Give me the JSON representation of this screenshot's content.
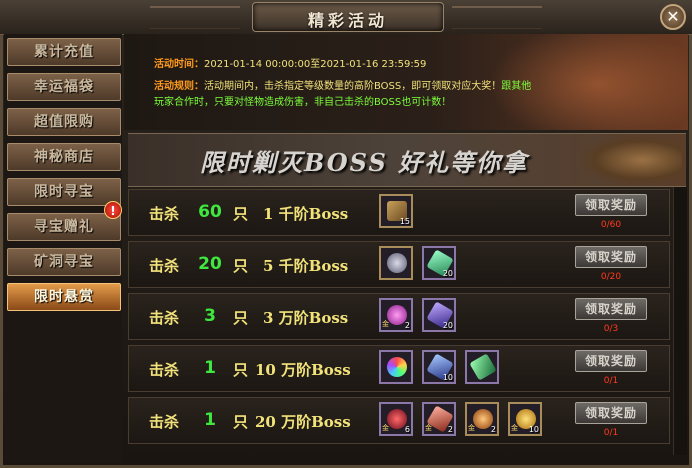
{
  "window": {
    "title": "精彩活动",
    "close_icon": "close-icon"
  },
  "sidebar": {
    "items": [
      {
        "label": "累计充值"
      },
      {
        "label": "幸运福袋"
      },
      {
        "label": "超值限购"
      },
      {
        "label": "神秘商店"
      },
      {
        "label": "限时寻宝"
      },
      {
        "label": "寻宝赠礼"
      },
      {
        "label": "矿洞寻宝",
        "badge": "!"
      },
      {
        "label": "限时悬赏",
        "active": true
      }
    ]
  },
  "info": {
    "time_label": "活动时间：",
    "time_value": "2021-01-14 00:00:00至2021-01-16 23:59:59",
    "rule_label": "活动规则：",
    "rule_text_1": "活动期间内，击杀指定等级数量的高阶BOSS，即可领取对应大奖！",
    "rule_text_green_1": "跟其他",
    "rule_text_green_2": "玩家合作时，只要对怪物造成伤害，非自己击杀的BOSS也可计数！"
  },
  "banner": {
    "text": "限时剿灭BOSS  好礼等你拿"
  },
  "rows": [
    {
      "kill": "击杀",
      "count": "60",
      "unit": "只",
      "boss": "1  千阶Boss",
      "claim": "领取奖励",
      "progress": "0/60",
      "items": [
        {
          "icon": "treasure-chest-icon",
          "qty": "15"
        }
      ]
    },
    {
      "kill": "击杀",
      "count": "20",
      "unit": "只",
      "boss": "5  千阶Boss",
      "claim": "领取奖励",
      "progress": "0/20",
      "items": [
        {
          "icon": "coin-icon",
          "qty": ""
        },
        {
          "icon": "green-crystal-icon",
          "qty": "20"
        }
      ]
    },
    {
      "kill": "击杀",
      "count": "3",
      "unit": "只",
      "boss": "3  万阶Boss",
      "claim": "领取奖励",
      "progress": "0/3",
      "items": [
        {
          "icon": "purple-gem-icon",
          "qty": "2"
        },
        {
          "icon": "purple-crystal-icon",
          "qty": "20"
        }
      ]
    },
    {
      "kill": "击杀",
      "count": "1",
      "unit": "只",
      "boss": "10 万阶Boss",
      "claim": "领取奖励",
      "progress": "0/1",
      "items": [
        {
          "icon": "rainbow-orb-icon",
          "qty": ""
        },
        {
          "icon": "blue-crystal-icon",
          "qty": "10"
        },
        {
          "icon": "green-shard-icon",
          "qty": ""
        }
      ]
    },
    {
      "kill": "击杀",
      "count": "1",
      "unit": "只",
      "boss": "20 万阶Boss",
      "claim": "领取奖励",
      "progress": "0/1",
      "items": [
        {
          "icon": "red-gem-icon",
          "qty": "6"
        },
        {
          "icon": "red-crystal-icon",
          "qty": "2"
        },
        {
          "icon": "orange-orb-icon",
          "qty": "2"
        },
        {
          "icon": "legend-coin-icon",
          "qty": "10"
        }
      ]
    }
  ]
}
